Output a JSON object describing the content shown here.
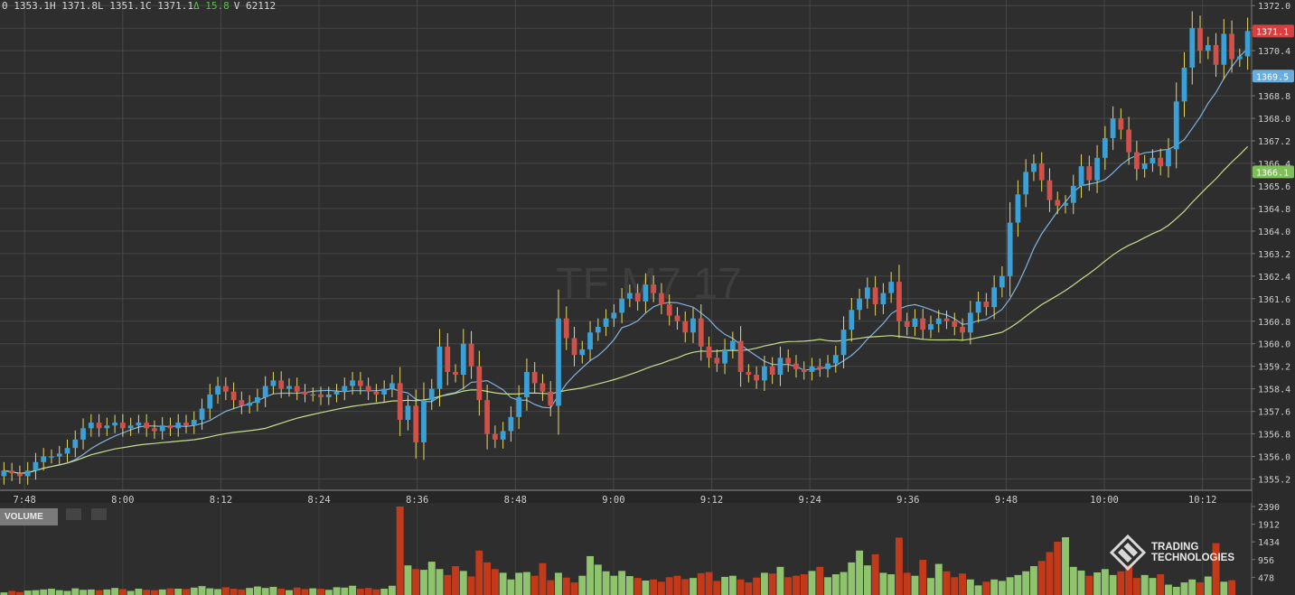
{
  "header": {
    "open": "0 1353.1H",
    "high": "1371.8L",
    "low": "1351.1C",
    "close": "1371.1",
    "delta_symbol": "Δ",
    "change": "15.8",
    "volume": "V 62112"
  },
  "watermark": "TF M7 17",
  "volume_panel": {
    "label": "VOLUME"
  },
  "logo": {
    "line1": "TRADING",
    "line2": "TECHNOLOGIES"
  },
  "colors": {
    "up": "#3aa0d6",
    "down": "#d0504a",
    "vol_up": "#8fc36e",
    "vol_down": "#c23a1a",
    "profile_blue": "#1e5c80",
    "profile_red": "#7a2a32",
    "ma_fast": "#7fb3e0",
    "ma_slow": "#c6e08c"
  },
  "chart_data": {
    "type": "candlestick",
    "price_axis": {
      "range": [
        1354.8,
        1372.2
      ],
      "ticks": [
        "1355.2",
        "1356.0",
        "1356.8",
        "1357.6",
        "1358.4",
        "1359.2",
        "1360.0",
        "1360.8",
        "1361.6",
        "1362.4",
        "1363.2",
        "1364.0",
        "1364.8",
        "1365.6",
        "1366.4",
        "1367.2",
        "1368.0",
        "1368.8",
        "1369.6",
        "1370.4",
        "1371.2",
        "1372.0"
      ],
      "price_labels": [
        {
          "text": "1371.1",
          "value": 1371.1,
          "color": "#d64040"
        },
        {
          "text": "1369.5",
          "value": 1369.5,
          "color": "#6aaee0"
        },
        {
          "text": "1366.1",
          "value": 1366.1,
          "color": "#7fbf5a"
        }
      ]
    },
    "time_axis": {
      "labels": [
        "7:48",
        "8:00",
        "8:12",
        "8:24",
        "8:36",
        "8:48",
        "9:00",
        "9:12",
        "9:24",
        "9:36",
        "9:48",
        "10:00",
        "10:12"
      ],
      "start_minute": 465,
      "end_minute": 618,
      "bars_per_label": 12
    },
    "volume_axis": {
      "ticks": [
        "478",
        "956",
        "1434",
        "1912",
        "2390"
      ],
      "max": 2390
    },
    "closes": [
      1355.5,
      1355.4,
      1355.3,
      1355.5,
      1355.8,
      1356.0,
      1356.0,
      1356.1,
      1356.3,
      1356.6,
      1357.0,
      1357.2,
      1357.0,
      1357.1,
      1357.2,
      1357.0,
      1357.1,
      1357.2,
      1357.0,
      1356.9,
      1357.1,
      1357.0,
      1357.2,
      1357.1,
      1357.3,
      1357.7,
      1358.2,
      1358.5,
      1358.3,
      1358.0,
      1357.8,
      1357.9,
      1358.1,
      1358.5,
      1358.7,
      1358.4,
      1358.5,
      1358.3,
      1358.2,
      1358.2,
      1358.1,
      1358.2,
      1358.3,
      1358.5,
      1358.7,
      1358.5,
      1358.3,
      1358.2,
      1358.4,
      1358.6,
      1357.3,
      1357.8,
      1356.5,
      1358.0,
      1358.4,
      1359.9,
      1359.0,
      1358.9,
      1360.0,
      1359.2,
      1358.0,
      1356.8,
      1356.6,
      1356.9,
      1357.4,
      1358.1,
      1359.0,
      1358.6,
      1358.3,
      1357.8,
      1360.9,
      1360.2,
      1359.6,
      1359.8,
      1360.4,
      1360.6,
      1360.9,
      1361.1,
      1361.6,
      1361.8,
      1361.5,
      1362.1,
      1361.8,
      1361.4,
      1361.0,
      1360.8,
      1360.4,
      1360.9,
      1359.9,
      1359.5,
      1359.3,
      1359.8,
      1360.1,
      1359.0,
      1358.9,
      1358.7,
      1359.2,
      1358.9,
      1359.5,
      1359.3,
      1359.1,
      1359.0,
      1359.2,
      1359.1,
      1359.3,
      1359.6,
      1360.5,
      1361.2,
      1361.6,
      1362.0,
      1361.4,
      1361.8,
      1362.2,
      1360.8,
      1360.6,
      1360.9,
      1360.5,
      1360.7,
      1360.9,
      1360.8,
      1360.6,
      1360.4,
      1361.1,
      1361.5,
      1361.3,
      1362.0,
      1362.4,
      1364.3,
      1365.3,
      1366.1,
      1366.4,
      1365.8,
      1365.1,
      1364.9,
      1365.0,
      1365.6,
      1366.3,
      1365.8,
      1366.6,
      1367.3,
      1368.0,
      1367.6,
      1366.8,
      1366.2,
      1366.4,
      1366.6,
      1366.3,
      1366.9,
      1368.6,
      1369.8,
      1371.2,
      1370.4,
      1370.6,
      1369.9,
      1371.0,
      1370.1,
      1370.2,
      1371.1
    ],
    "volumes": [
      70,
      110,
      80,
      120,
      130,
      150,
      170,
      130,
      110,
      180,
      140,
      150,
      130,
      150,
      190,
      160,
      110,
      170,
      140,
      130,
      150,
      180,
      170,
      160,
      200,
      240,
      180,
      160,
      210,
      170,
      150,
      190,
      230,
      190,
      220,
      170,
      130,
      200,
      160,
      180,
      170,
      140,
      210,
      200,
      250,
      170,
      190,
      150,
      170,
      250,
      2390,
      800,
      700,
      680,
      900,
      700,
      540,
      780,
      650,
      500,
      1200,
      880,
      700,
      600,
      420,
      600,
      620,
      520,
      860,
      400,
      600,
      470,
      340,
      520,
      1050,
      820,
      640,
      520,
      650,
      510,
      460,
      390,
      420,
      360,
      480,
      520,
      430,
      460,
      590,
      620,
      380,
      490,
      520,
      420,
      340,
      470,
      600,
      580,
      760,
      480,
      520,
      560,
      650,
      760,
      480,
      560,
      620,
      880,
      1200,
      800,
      1100,
      600,
      560,
      1550,
      600,
      520,
      950,
      460,
      840,
      640,
      480,
      580,
      420,
      260,
      360,
      420,
      380,
      480,
      540,
      640,
      780,
      920,
      1160,
      1440,
      1560,
      760,
      660,
      520,
      610,
      700,
      540,
      640,
      800,
      460,
      540,
      460,
      560,
      280,
      220,
      340,
      420,
      340,
      500,
      1400,
      360,
      400
    ]
  }
}
